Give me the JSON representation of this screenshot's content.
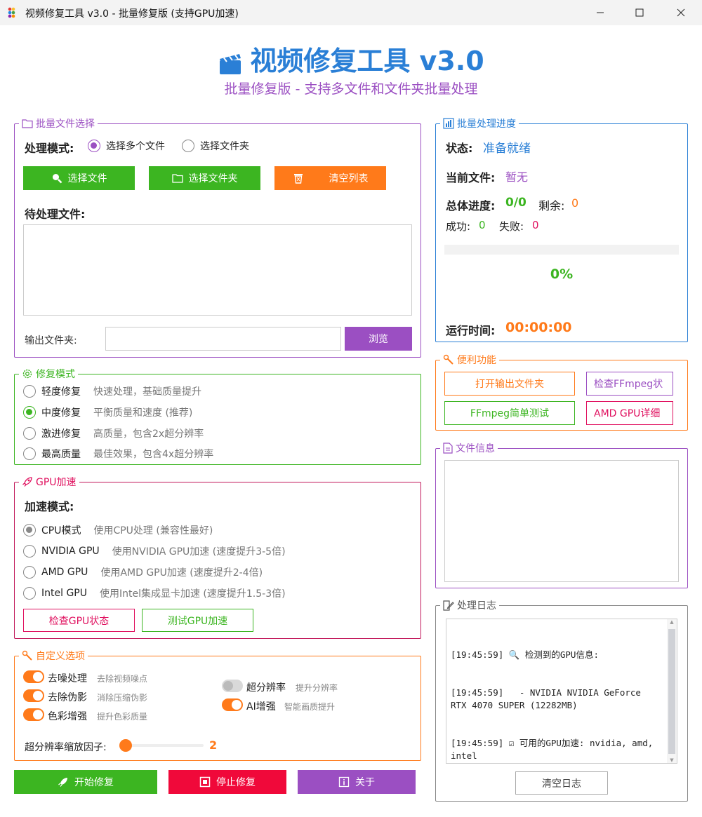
{
  "window": {
    "title": "视频修复工具 v3.0 - 批量修复版 (支持GPU加速)"
  },
  "header": {
    "title": "视频修复工具 v3.0",
    "subtitle": "批量修复版 - 支持多文件和文件夹批量处理"
  },
  "file_select": {
    "legend": "批量文件选择",
    "mode_label": "处理模式:",
    "mode_options": [
      "选择多个文件",
      "选择文件夹"
    ],
    "selected_mode": "选择多个文件",
    "btn_select_files": "选择文件",
    "btn_select_folder": "选择文件夹",
    "btn_clear": "清空列表",
    "pending_label": "待处理文件:",
    "output_label": "输出文件夹:",
    "output_value": "",
    "btn_browse": "浏览"
  },
  "repair_mode": {
    "legend": "修复模式",
    "options": [
      {
        "label": "轻度修复",
        "desc": "快速处理，基础质量提升"
      },
      {
        "label": "中度修复",
        "desc": "平衡质量和速度 (推荐)"
      },
      {
        "label": "激进修复",
        "desc": "高质量，包含2x超分辨率"
      },
      {
        "label": "最高质量",
        "desc": "最佳效果，包含4x超分辨率"
      }
    ],
    "selected": "中度修复"
  },
  "gpu": {
    "legend": "GPU加速",
    "mode_label": "加速模式:",
    "options": [
      {
        "label": "CPU模式",
        "desc": "使用CPU处理 (兼容性最好)"
      },
      {
        "label": "NVIDIA GPU",
        "desc": "使用NVIDIA GPU加速 (速度提升3-5倍)"
      },
      {
        "label": "AMD GPU",
        "desc": "使用AMD GPU加速 (速度提升2-4倍)"
      },
      {
        "label": "Intel GPU",
        "desc": "使用Intel集成显卡加速 (速度提升1.5-3倍)"
      }
    ],
    "selected": "CPU模式",
    "btn_check": "检查GPU状态",
    "btn_test": "测试GPU加速"
  },
  "custom": {
    "legend": "自定义选项",
    "options": [
      {
        "label": "去噪处理",
        "desc": "去除视频噪点",
        "on": true
      },
      {
        "label": "去除伪影",
        "desc": "消除压缩伪影",
        "on": true
      },
      {
        "label": "色彩增强",
        "desc": "提升色彩质量",
        "on": true
      },
      {
        "label": "超分辨率",
        "desc": "提升分辨率",
        "on": false
      },
      {
        "label": "AI增强",
        "desc": "智能画质提升",
        "on": true
      }
    ],
    "scale_label": "超分辨率缩放因子:",
    "scale_value": "2",
    "scale_fraction": 0.02
  },
  "actions": {
    "start": "开始修复",
    "stop": "停止修复",
    "about": "关于"
  },
  "progress": {
    "legend": "批量处理进度",
    "status_label": "状态:",
    "status_value": "准备就绪",
    "current_label": "当前文件:",
    "current_value": "暂无",
    "total_label": "总体进度:",
    "total_value": "0/0",
    "remaining_label": "剩余:",
    "remaining_value": "0",
    "success_label": "成功:",
    "success_value": "0",
    "fail_label": "失败:",
    "fail_value": "0",
    "percent": "0%",
    "fraction": 0,
    "time_label": "运行时间:",
    "time_value": "00:00:00"
  },
  "tools": {
    "legend": "便利功能",
    "btn_open_output": "打开输出文件夹",
    "btn_check_ffmpeg": "检查FFmpeg状",
    "btn_ffmpeg_test": "FFmpeg简单测试",
    "btn_amd_detail": "AMD GPU详细"
  },
  "file_info": {
    "legend": "文件信息"
  },
  "log": {
    "legend": "处理日志",
    "lines": [
      "[19:45:59] 🔍 检测到的GPU信息:",
      "[19:45:59]   - NVIDIA NVIDIA GeForce RTX 4070 SUPER (12282MB)",
      "[19:45:59] ☑ 可用的GPU加速: nvidia, amd, intel"
    ],
    "btn_clear": "清空日志"
  },
  "colors": {
    "accent_blue": "#2a7fd6",
    "purple": "#9b4fc2",
    "green": "#3cb521",
    "orange": "#ff7a1a",
    "red": "#f0093a"
  }
}
